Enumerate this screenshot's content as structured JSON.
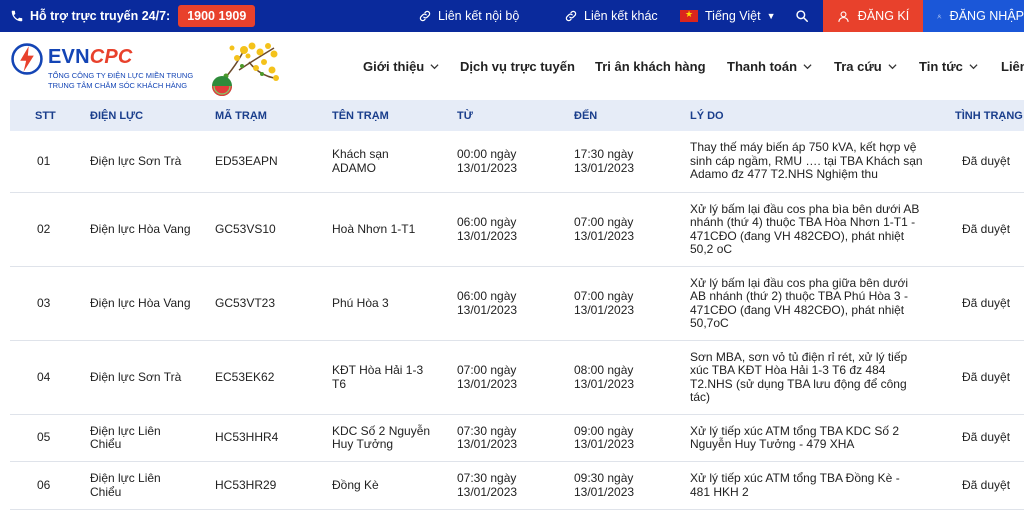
{
  "topbar": {
    "support_label": "Hỗ trợ trực truyến 24/7:",
    "hotline": "1900 1909",
    "internal_link": "Liên kết nội bộ",
    "external_link": "Liên kết khác",
    "language": "Tiếng Việt",
    "register": "ĐĂNG KÍ",
    "login": "ĐĂNG NHẬP"
  },
  "header": {
    "logo_evn": "EVN",
    "logo_cpc": "CPC",
    "logo_sub1": "TỔNG CÔNG TY ĐIỆN LỰC MIỀN TRUNG",
    "logo_sub2": "TRUNG TÂM CHĂM SÓC KHÁCH HÀNG",
    "nav": [
      "Giới thiệu",
      "Dịch vụ trực tuyến",
      "Tri ân khách hàng",
      "Thanh toán",
      "Tra cứu",
      "Tin tức",
      "Liên"
    ]
  },
  "table": {
    "headers": [
      "STT",
      "ĐIỆN LỰC",
      "MÃ TRẠM",
      "TÊN TRẠM",
      "TỪ",
      "ĐẾN",
      "LÝ DO",
      "TÌNH TRẠNG"
    ],
    "rows": [
      {
        "stt": "01",
        "dien_luc": [
          "Điện lực Sơn Trà"
        ],
        "ma_tram": "ED53EAPN",
        "ten_tram": [
          "Khách sạn",
          "ADAMO"
        ],
        "tu": [
          "00:00 ngày",
          "13/01/2023"
        ],
        "den": [
          "17:30 ngày",
          "13/01/2023"
        ],
        "ly_do": [
          "Thay thế máy biến áp 750 kVA, kết hợp vệ",
          "sinh cáp ngầm, RMU …. tại TBA Khách sạn",
          "Adamo đz 477 T2.NHS Nghiệm thu"
        ],
        "tinh_trang": "Đã duyệt"
      },
      {
        "stt": "02",
        "dien_luc": [
          "Điện lực Hòa Vang"
        ],
        "ma_tram": "GC53VS10",
        "ten_tram": [
          "Hoà Nhơn 1-T1"
        ],
        "tu": [
          "06:00 ngày",
          "13/01/2023"
        ],
        "den": [
          "07:00 ngày",
          "13/01/2023"
        ],
        "ly_do": [
          "Xử lý bấm lại đầu cos pha bìa bên dưới AB",
          "nhánh (thứ 4) thuộc TBA Hòa Nhơn 1-T1 -",
          "471CĐO (đang VH 482CĐO), phát nhiệt",
          "50,2 oC"
        ],
        "tinh_trang": "Đã duyệt"
      },
      {
        "stt": "03",
        "dien_luc": [
          "Điện lực Hòa Vang"
        ],
        "ma_tram": "GC53VT23",
        "ten_tram": [
          "Phú Hòa 3"
        ],
        "tu": [
          "06:00 ngày",
          "13/01/2023"
        ],
        "den": [
          "07:00 ngày",
          "13/01/2023"
        ],
        "ly_do": [
          "Xử lý bấm lại đầu cos pha giữa bên dưới",
          "AB nhánh (thứ 2) thuộc TBA Phú Hòa 3 -",
          "471CĐO (đang VH 482CĐO), phát nhiệt",
          "50,7oC"
        ],
        "tinh_trang": "Đã duyệt"
      },
      {
        "stt": "04",
        "dien_luc": [
          "Điện lực Sơn Trà"
        ],
        "ma_tram": "EC53EK62",
        "ten_tram": [
          "KĐT Hòa Hải 1-3",
          "T6"
        ],
        "tu": [
          "07:00 ngày",
          "13/01/2023"
        ],
        "den": [
          "08:00 ngày",
          "13/01/2023"
        ],
        "ly_do": [
          "Sơn MBA, sơn vỏ tủ điện rỉ rét, xử lý tiếp",
          "xúc TBA KĐT Hòa Hải 1-3 T6 đz 484",
          "T2.NHS (sử dụng TBA lưu động để công",
          "tác)"
        ],
        "tinh_trang": "Đã duyệt"
      },
      {
        "stt": "05",
        "dien_luc": [
          "Điện lực Liên",
          "Chiểu"
        ],
        "ma_tram": "HC53HHR4",
        "ten_tram": [
          "KDC Số 2 Nguyễn",
          "Huy Tưởng"
        ],
        "tu": [
          "07:30 ngày",
          "13/01/2023"
        ],
        "den": [
          "09:00 ngày",
          "13/01/2023"
        ],
        "ly_do": [
          "Xử lý tiếp xúc ATM tổng TBA KDC Số 2",
          "Nguyễn Huy Tưởng - 479 XHA"
        ],
        "tinh_trang": "Đã duyệt"
      },
      {
        "stt": "06",
        "dien_luc": [
          "Điện lực Liên",
          "Chiểu"
        ],
        "ma_tram": "HC53HR29",
        "ten_tram": [
          "Đồng Kè"
        ],
        "tu": [
          "07:30 ngày",
          "13/01/2023"
        ],
        "den": [
          "09:30 ngày",
          "13/01/2023"
        ],
        "ly_do": [
          "Xử lý tiếp xúc ATM tổng TBA Đồng Kè -",
          "481 HKH 2"
        ],
        "tinh_trang": "Đã duyệt"
      }
    ]
  },
  "colors": {
    "topbar_bg": "#0a2a9c",
    "accent_red": "#e8412c",
    "login_blue": "#1b57d8",
    "table_header_bg": "#e6ecf7"
  },
  "icons": [
    "phone-icon",
    "link-icon",
    "vietnam-flag-icon",
    "search-icon",
    "user-icon",
    "chevron-down-icon"
  ]
}
